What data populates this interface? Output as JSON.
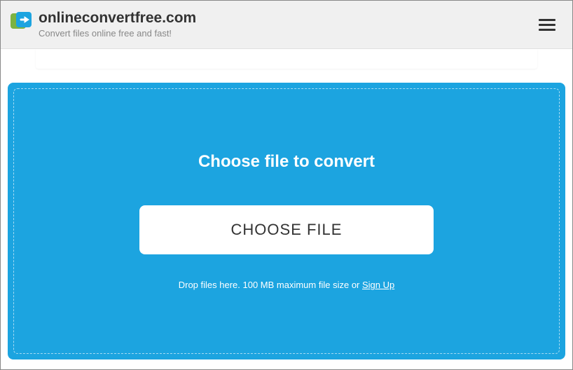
{
  "header": {
    "site_name": "onlineconvertfree.com",
    "tagline": "Convert files online free and fast!"
  },
  "dropzone": {
    "title": "Choose file to convert",
    "button_label": "CHOOSE FILE",
    "helper_prefix": "Drop files here. 100 MB maximum file size or ",
    "signup_label": "Sign Up"
  }
}
